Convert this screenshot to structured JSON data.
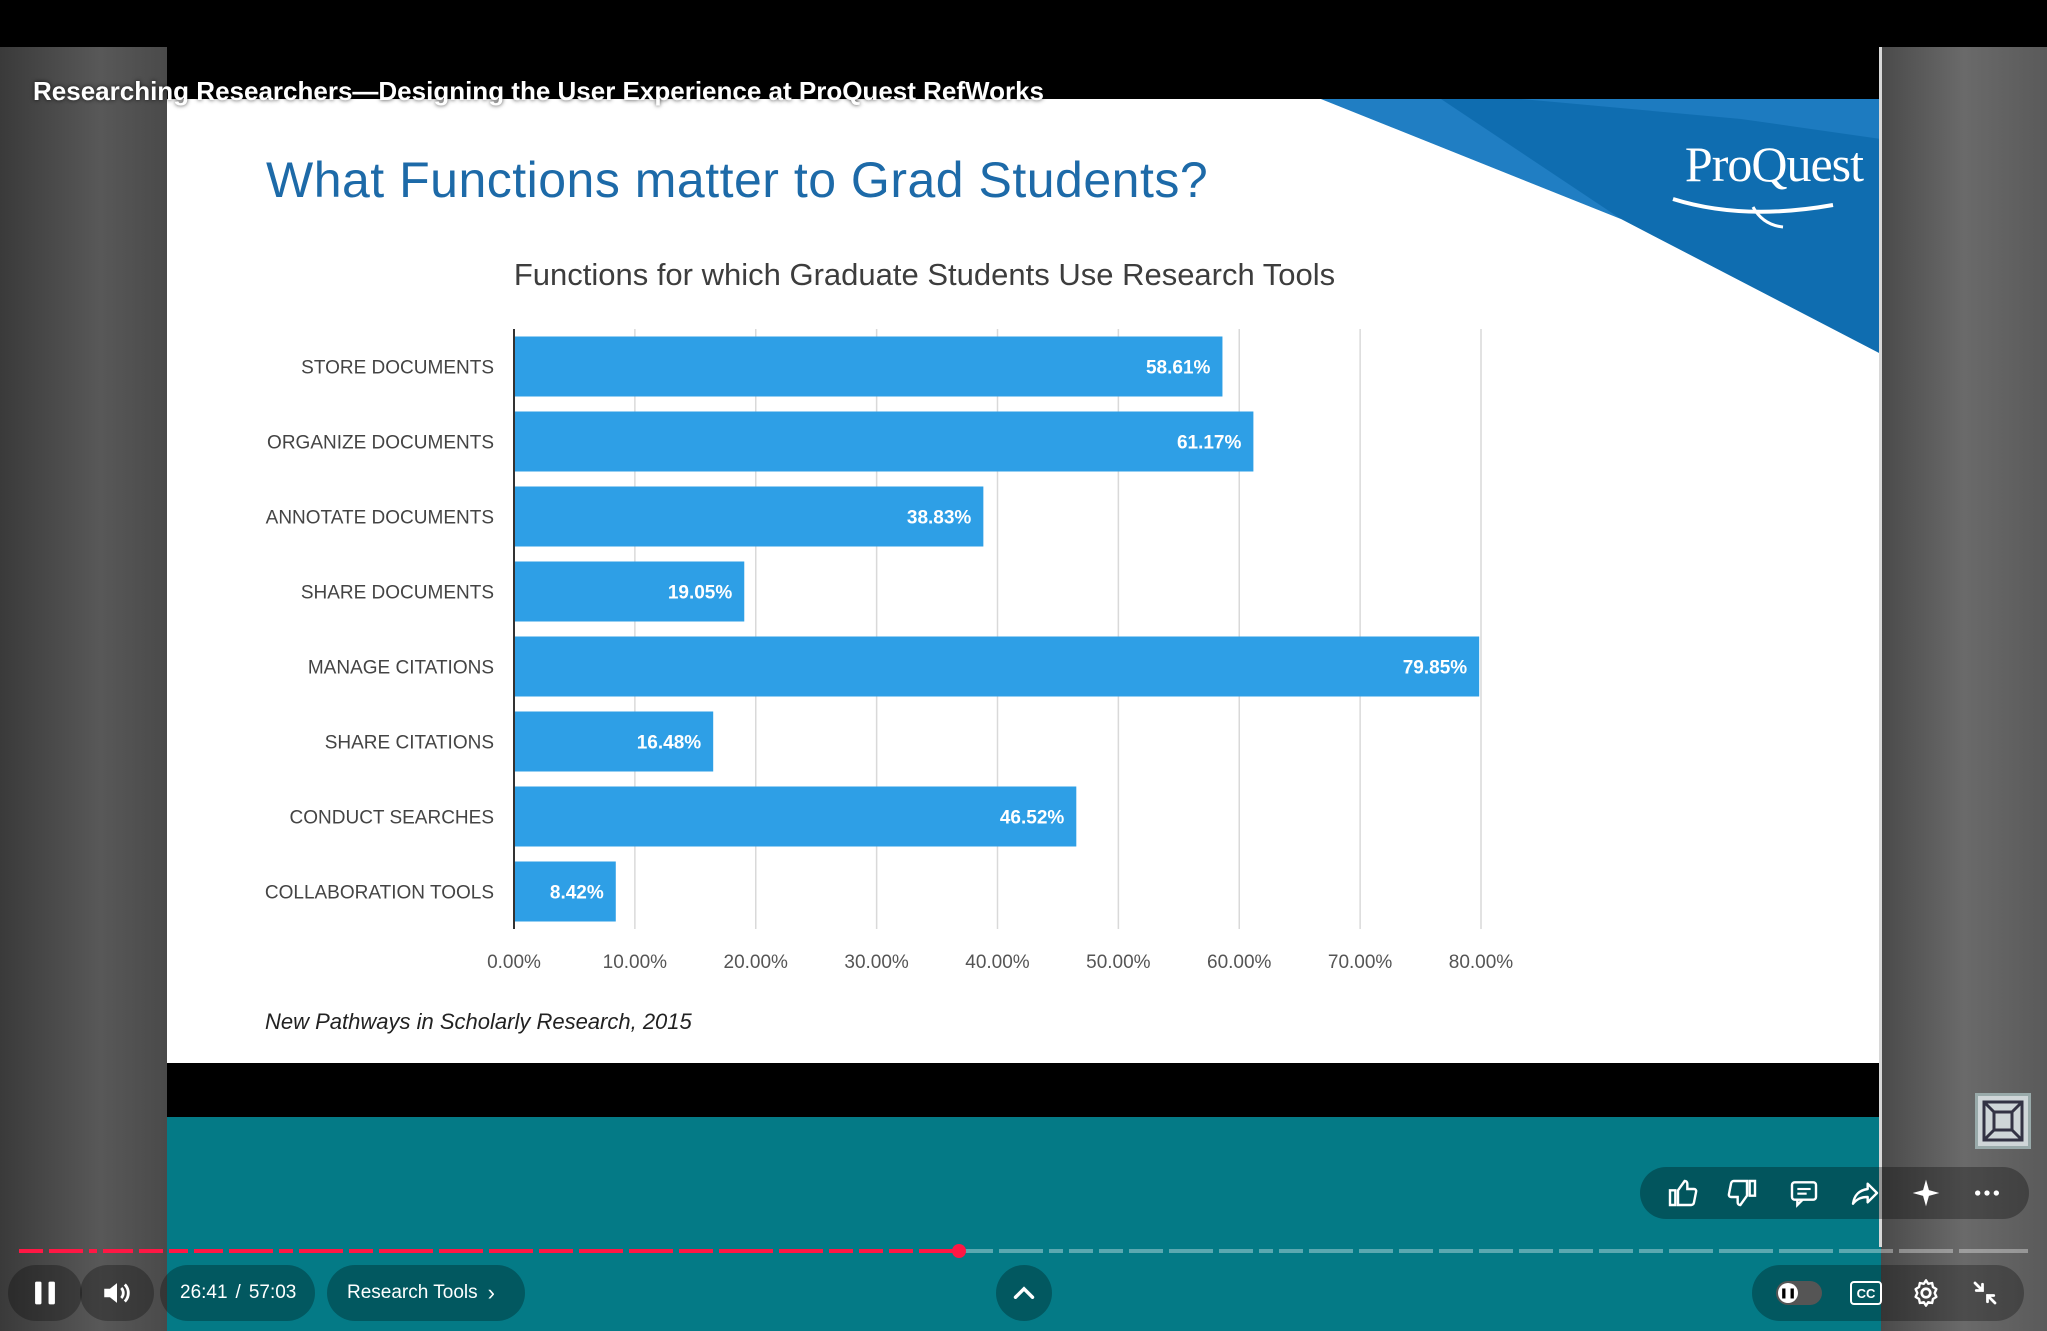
{
  "video": {
    "title": "Researching Researchers—Designing the User Experience at ProQuest RefWorks"
  },
  "slide": {
    "title": "What Functions matter to Grad Students?",
    "logo_text": "ProQuest",
    "source_note": "New Pathways in Scholarly Research, 2015"
  },
  "chart_data": {
    "type": "bar",
    "orientation": "horizontal",
    "title": "Functions for which Graduate Students Use Research Tools",
    "categories": [
      "STORE DOCUMENTS",
      "ORGANIZE DOCUMENTS",
      "ANNOTATE DOCUMENTS",
      "SHARE DOCUMENTS",
      "MANAGE CITATIONS",
      "SHARE CITATIONS",
      "CONDUCT SEARCHES",
      "COLLABORATION TOOLS"
    ],
    "values": [
      58.61,
      61.17,
      38.83,
      19.05,
      79.85,
      16.48,
      46.52,
      8.42
    ],
    "value_labels": [
      "58.61%",
      "61.17%",
      "38.83%",
      "19.05%",
      "79.85%",
      "16.48%",
      "46.52%",
      "8.42%"
    ],
    "xlim": [
      0,
      80
    ],
    "ticks": [
      0,
      10,
      20,
      30,
      40,
      50,
      60,
      70,
      80
    ],
    "tick_labels": [
      "0.00%",
      "10.00%",
      "20.00%",
      "30.00%",
      "40.00%",
      "50.00%",
      "60.00%",
      "70.00%",
      "80.00%"
    ],
    "bar_color": "#2e9fe6",
    "grid": true
  },
  "controls": {
    "current_time": "26:41",
    "duration": "57:03",
    "time_separator": "/",
    "chapter_label": "Research Tools",
    "progress": 0.468
  },
  "colors": {
    "teal": "#047a86",
    "progress_red": "#ff1744",
    "title_blue": "#1d6aa8",
    "logo_blue": "#0f6db0"
  }
}
